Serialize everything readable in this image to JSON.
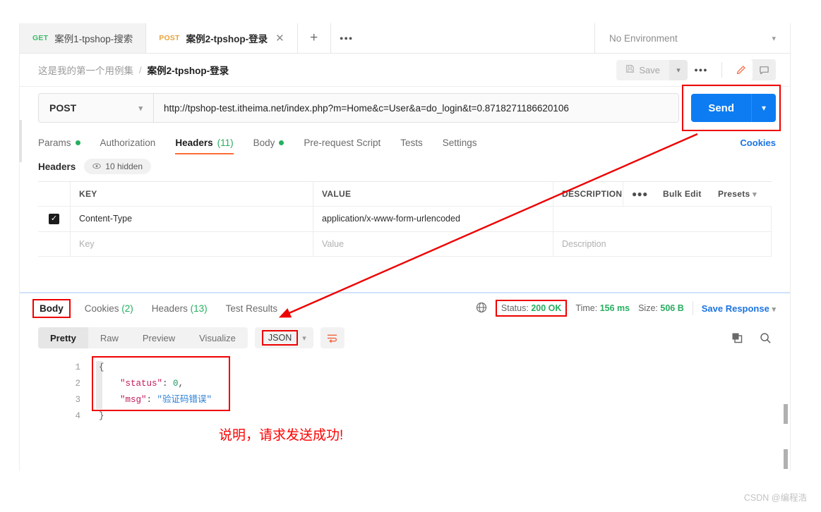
{
  "tabs": [
    {
      "method": "GET",
      "title": "案例1-tpshop-搜索",
      "active": false
    },
    {
      "method": "POST",
      "title": "案例2-tpshop-登录",
      "active": true
    }
  ],
  "tabbar": {
    "new_tab": "+",
    "more": "●●●",
    "close": "✕",
    "environment": "No Environment"
  },
  "breadcrumb": {
    "collection": "这是我的第一个用例集",
    "separator": "/",
    "current": "案例2-tpshop-登录",
    "save_label": "Save",
    "more": "●●●"
  },
  "request": {
    "method": "POST",
    "url": "http://tpshop-test.itheima.net/index.php?m=Home&c=User&a=do_login&t=0.8718271186620106",
    "send_label": "Send"
  },
  "request_tabs": [
    {
      "label": "Params",
      "dot": true,
      "count": "",
      "active": false
    },
    {
      "label": "Authorization",
      "dot": false,
      "count": "",
      "active": false
    },
    {
      "label": "Headers",
      "dot": false,
      "count": "(11)",
      "active": true
    },
    {
      "label": "Body",
      "dot": true,
      "count": "",
      "active": false
    },
    {
      "label": "Pre-request Script",
      "dot": false,
      "count": "",
      "active": false
    },
    {
      "label": "Tests",
      "dot": false,
      "count": "",
      "active": false
    },
    {
      "label": "Settings",
      "dot": false,
      "count": "",
      "active": false
    }
  ],
  "cookies_link": "Cookies",
  "headers_section": {
    "label": "Headers",
    "hidden_pill": "10 hidden",
    "columns": {
      "key": "KEY",
      "value": "VALUE",
      "description": "DESCRIPTION",
      "dots": "●●●",
      "bulk_edit": "Bulk Edit",
      "presets": "Presets"
    },
    "rows": [
      {
        "checked": true,
        "key": "Content-Type",
        "value": "application/x-www-form-urlencoded",
        "description": ""
      }
    ],
    "placeholder_row": {
      "key": "Key",
      "value": "Value",
      "description": "Description"
    }
  },
  "response_tabs": [
    {
      "label": "Body",
      "count": "",
      "active": true,
      "boxed": true
    },
    {
      "label": "Cookies",
      "count": "(2)",
      "active": false,
      "boxed": false
    },
    {
      "label": "Headers",
      "count": "(13)",
      "active": false,
      "boxed": false
    },
    {
      "label": "Test Results",
      "count": "",
      "active": false,
      "boxed": false
    }
  ],
  "response_meta": {
    "status_label": "Status:",
    "status_value": "200 OK",
    "time_label": "Time:",
    "time_value": "156 ms",
    "size_label": "Size:",
    "size_value": "506 B",
    "save_response": "Save Response"
  },
  "body_toolbar": {
    "segments": [
      {
        "label": "Pretty",
        "active": true
      },
      {
        "label": "Raw",
        "active": false
      },
      {
        "label": "Preview",
        "active": false
      },
      {
        "label": "Visualize",
        "active": false
      }
    ],
    "format": "JSON"
  },
  "response_body": {
    "line_numbers": [
      "1",
      "2",
      "3",
      "4"
    ],
    "lines": [
      [
        {
          "t": "brace",
          "s": "{"
        }
      ],
      [
        {
          "t": "key",
          "s": "    \"status\""
        },
        {
          "t": "punc",
          "s": ": "
        },
        {
          "t": "num",
          "s": "0"
        },
        {
          "t": "punc",
          "s": ","
        }
      ],
      [
        {
          "t": "key",
          "s": "    \"msg\""
        },
        {
          "t": "punc",
          "s": ": "
        },
        {
          "t": "str",
          "s": "\"验证码错误\""
        }
      ],
      [
        {
          "t": "brace",
          "s": "}"
        }
      ]
    ],
    "raw": "{\n    \"status\": 0,\n    \"msg\": \"验证码错误\"\n}"
  },
  "annotation": {
    "note": "说明，请求发送成功!",
    "accent_color": "#ff0000"
  },
  "watermark": "CSDN @编程浩",
  "colors": {
    "send_blue": "#0d7cf2",
    "accent_orange": "#ff6c37",
    "success_green": "#27ae60",
    "link_blue": "#1a74e2",
    "annotation_red": "#ee0000"
  }
}
